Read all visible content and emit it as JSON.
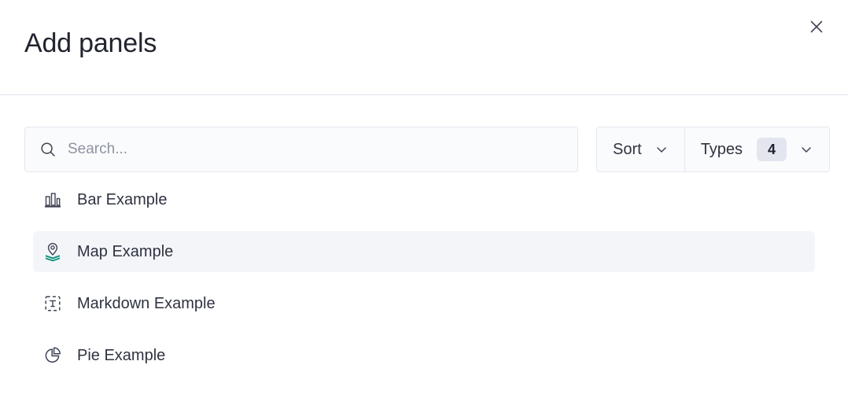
{
  "header": {
    "title": "Add panels",
    "close_icon": "close-icon"
  },
  "toolbar": {
    "search": {
      "icon": "search-icon",
      "value": "",
      "placeholder": "Search..."
    },
    "sort": {
      "label": "Sort",
      "icon": "chevron-down-icon"
    },
    "types": {
      "label": "Types",
      "count": "4",
      "icon": "chevron-down-icon"
    }
  },
  "list": {
    "items": [
      {
        "label": "Bar Example",
        "icon": "bar-chart-icon",
        "selected": false
      },
      {
        "label": "Map Example",
        "icon": "map-pin-layers-icon",
        "selected": true
      },
      {
        "label": "Markdown Example",
        "icon": "text-box-icon",
        "selected": false
      },
      {
        "label": "Pie Example",
        "icon": "pie-chart-icon",
        "selected": false
      }
    ]
  },
  "colors": {
    "text": "#2f3340",
    "title": "#21242e",
    "border": "#e4e7ee",
    "divider": "#dfe2ea",
    "field_bg": "#fafbfc",
    "row_selected_bg": "#f4f5f9",
    "badge_bg": "#e3e5ef",
    "placeholder": "#8e93a3",
    "map_accent": "#13937e"
  }
}
